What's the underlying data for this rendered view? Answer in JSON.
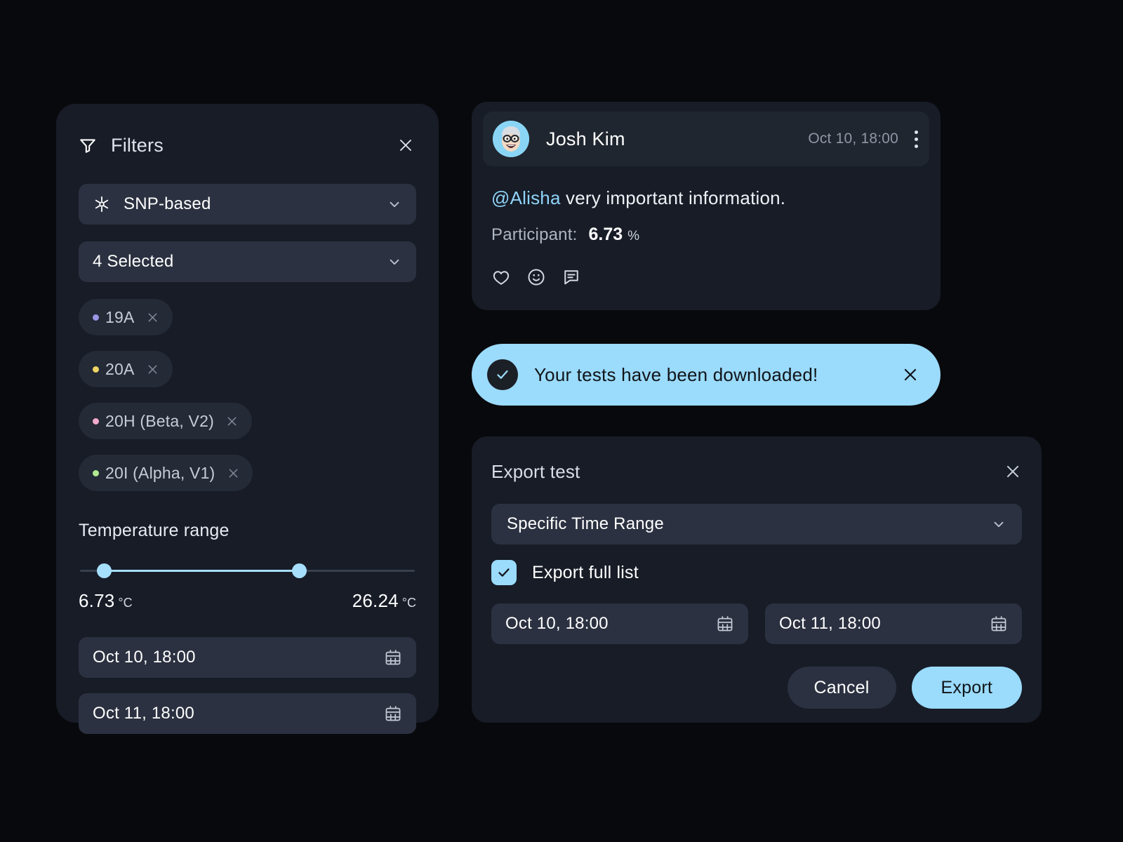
{
  "theme": {
    "page_bg": "#08090c",
    "panel_bg": "#171c27",
    "field_bg": "#2b3140",
    "chip_bg": "#242a36",
    "accent": "#9bdbfb",
    "text_primary": "#ffffff",
    "text_muted": "#8e97a6"
  },
  "filters": {
    "title": "Filters",
    "icon": "funnel-icon",
    "close_icon": "close-icon",
    "type_select": {
      "icon": "asterisk-medical-icon",
      "value": "SNP-based",
      "chevron": "chevron-down-icon"
    },
    "count_select": {
      "value": "4 Selected",
      "chevron": "chevron-down-icon"
    },
    "chips": [
      {
        "label": "19A",
        "dot_color": "#9b95e6",
        "remove_icon": "close-icon"
      },
      {
        "label": "20A",
        "dot_color": "#efd663",
        "remove_icon": "close-icon"
      },
      {
        "label": "20H (Beta, V2)",
        "dot_color": "#f2a9ca",
        "remove_icon": "close-icon"
      },
      {
        "label": "20I (Alpha, V1)",
        "dot_color": "#b2ea92",
        "remove_icon": "close-icon"
      }
    ],
    "temperature": {
      "title": "Temperature range",
      "min_value": "6.73",
      "min_unit": "°C",
      "max_value": "26.24",
      "max_unit": "°C",
      "slider_low_pct": 7.2,
      "slider_high_pct": 65.4
    },
    "date_from": {
      "value": "Oct 10, 18:00",
      "icon": "calendar-icon"
    },
    "date_to": {
      "value": "Oct 11, 18:00",
      "icon": "calendar-icon"
    }
  },
  "comment": {
    "author": "Josh Kim",
    "timestamp": "Oct 10, 18:00",
    "avatar_alt": "memoji-avatar",
    "menu_icon": "kebab-menu-icon",
    "mention": "@Alisha",
    "body": " very important information.",
    "participant_label": "Participant:",
    "participant_value": "6.73",
    "participant_unit": "%",
    "reactions": [
      "heart-icon",
      "smiley-icon",
      "comment-icon"
    ]
  },
  "toast": {
    "message": "Your tests have been downloaded!",
    "status_icon": "check-circle-icon",
    "close_icon": "close-icon"
  },
  "export_dialog": {
    "title": "Export test",
    "close_icon": "close-icon",
    "range_select": {
      "value": "Specific Time Range",
      "chevron": "chevron-down-icon"
    },
    "checkbox": {
      "label": "Export full list",
      "checked": true
    },
    "date_from": {
      "value": "Oct 10, 18:00",
      "icon": "calendar-icon"
    },
    "date_to": {
      "value": "Oct 11, 18:00",
      "icon": "calendar-icon"
    },
    "cancel_label": "Cancel",
    "export_label": "Export"
  }
}
